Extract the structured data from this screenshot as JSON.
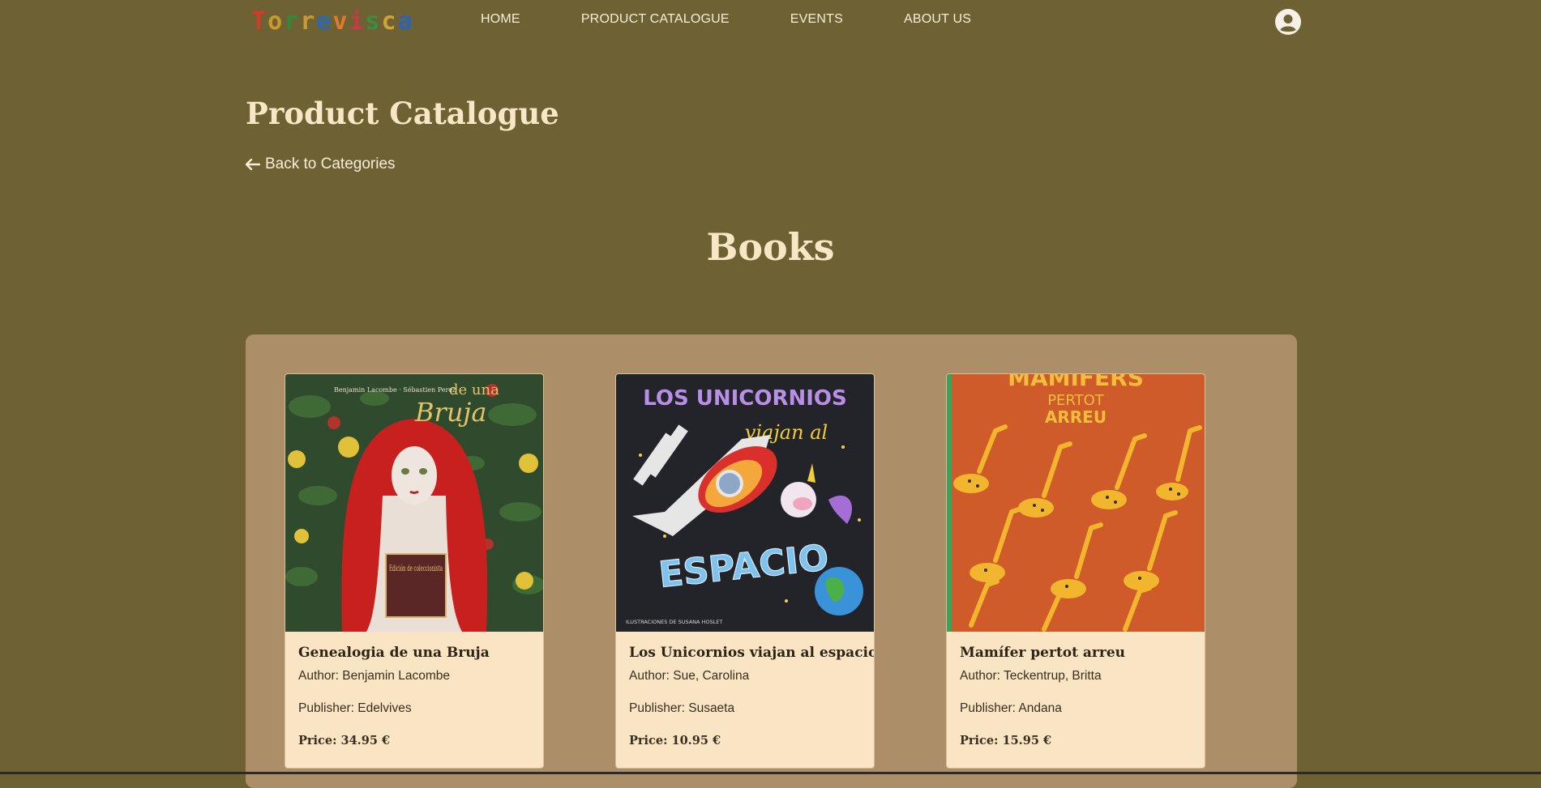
{
  "brand": {
    "letters": [
      "T",
      "o",
      "r",
      "r",
      "e",
      "v",
      "i",
      "s",
      "c",
      "a"
    ],
    "letter_colors": [
      "#d43a2a",
      "#c99a2a",
      "#2f8a3a",
      "#c79a34",
      "#2c6ab0",
      "#e07a2a",
      "#c63a46",
      "#3c8c43",
      "#d1a23a",
      "#2c63b5"
    ]
  },
  "nav": {
    "home": "HOME",
    "catalogue": "PRODUCT CATALOGUE",
    "events": "EVENTS",
    "about": "ABOUT US",
    "user_icon": "user-circle-icon"
  },
  "page": {
    "title": "Product Catalogue",
    "back_label": "Back to Categories",
    "section_title": "Books"
  },
  "books": [
    {
      "title": "Genealogia de una Bruja",
      "author": "Author: Benjamin Lacombe",
      "publisher": "Publisher: Edelvives",
      "price": "Price: 34.95 €",
      "cover_top": "de una",
      "cover_script": "Bruja",
      "cover_names": "Benjamin Lacombe · Sébastien Perez",
      "cover_book": "Edición de coleccionista"
    },
    {
      "title": "Los Unicornios viajan al espacio",
      "author": "Author: Sue, Carolina",
      "publisher": "Publisher: Susaeta",
      "price": "Price: 10.95 €",
      "cover_line1": "LOS UNICORNIOS",
      "cover_line2": "viajan al",
      "cover_line3": "ESPACIO",
      "cover_footer": "ILUSTRACIONES DE SUSANA HOSLET"
    },
    {
      "title": "Mamífer pertot arreu",
      "author": "Author: Teckentrup, Britta",
      "publisher": "Publisher: Andana",
      "price": "Price: 15.95 €",
      "cover_line1": "MAMÍFERS",
      "cover_line2": "PERTOT",
      "cover_line3": "ARREU"
    }
  ],
  "colors": {
    "background": "#6e6234",
    "panel": "#ac8f68",
    "card": "#f9e4c4",
    "heading": "#f8e6c4"
  }
}
